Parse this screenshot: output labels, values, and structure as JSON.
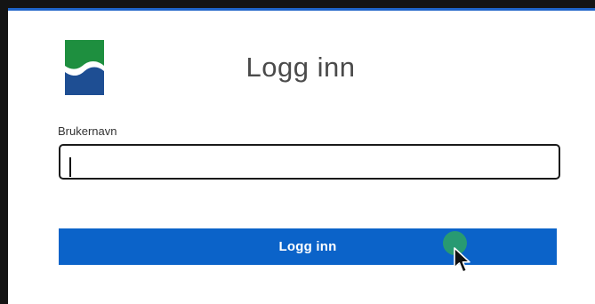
{
  "login": {
    "title": "Logg inn",
    "username_label": "Brukernavn",
    "username_value": "",
    "submit_label": "Logg inn"
  },
  "colors": {
    "accent": "#0b63c9",
    "logo_green": "#1e8f3f",
    "logo_blue": "#1e4e93",
    "click_indicator": "#2a9d6e"
  },
  "icons": {
    "logo": "bank-logo-icon",
    "cursor": "mouse-pointer-icon"
  }
}
